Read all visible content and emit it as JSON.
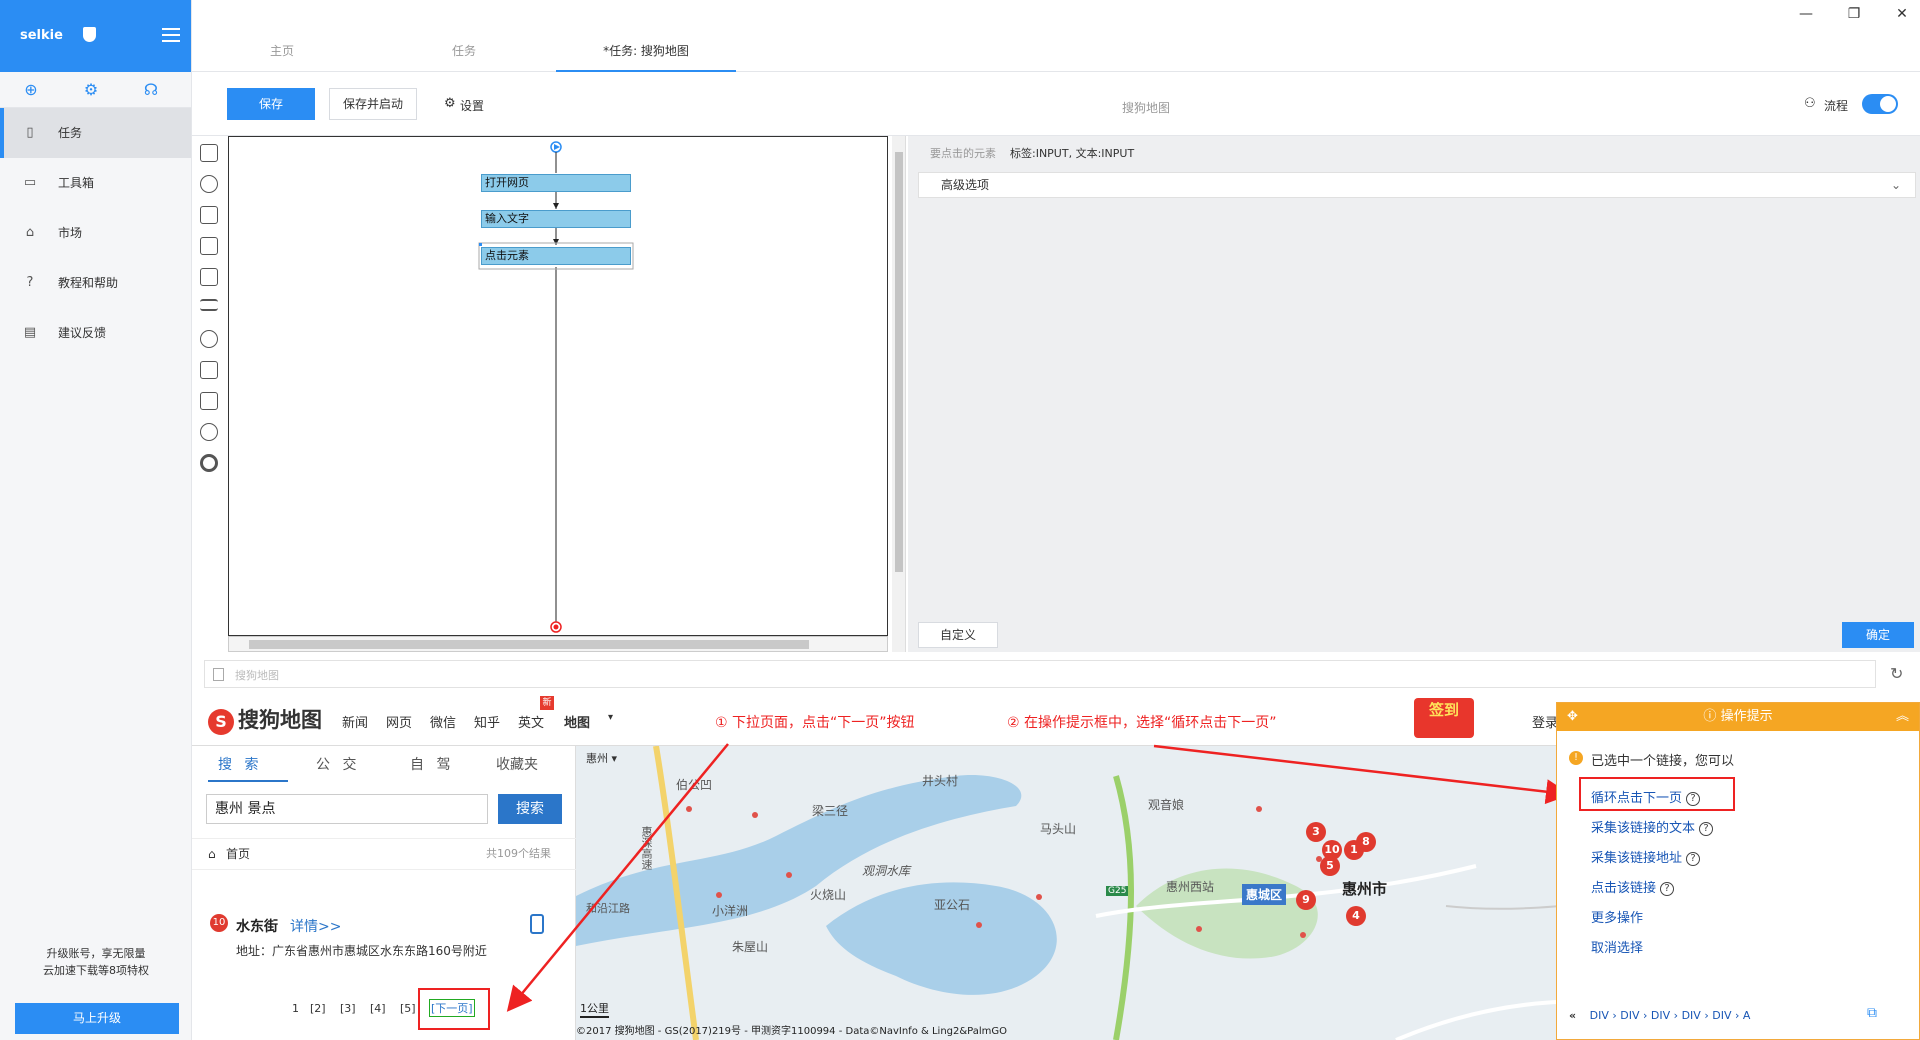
{
  "sidebar": {
    "brand": "selkie",
    "items": [
      {
        "label": "任务",
        "icon": "file-icon",
        "active": true
      },
      {
        "label": "工具箱",
        "icon": "toolbox-icon",
        "active": false
      },
      {
        "label": "市场",
        "icon": "lock-icon",
        "active": false
      },
      {
        "label": "教程和帮助",
        "icon": "help-icon",
        "active": false
      },
      {
        "label": "建议反馈",
        "icon": "feedback-icon",
        "active": false
      }
    ],
    "upgrade_line1": "升级账号，享无限量",
    "upgrade_line2": "云加速下载等8项特权",
    "upgrade_button": "马上升级"
  },
  "tabs": [
    {
      "label": "主页",
      "active": false
    },
    {
      "label": "任务",
      "active": false
    },
    {
      "label": "*任务: 搜狗地图",
      "active": true
    }
  ],
  "toolbar": {
    "save": "保存",
    "save_start": "保存并启动",
    "settings": "设置",
    "task_name": "搜狗地图",
    "flow_label": "流程",
    "flow_toggle_on": true
  },
  "flow": {
    "nodes": [
      "打开网页",
      "输入文字",
      "点击元素"
    ]
  },
  "props": {
    "target_label": "要点击的元素",
    "target_value": "标签:INPUT, 文本:INPUT",
    "advanced": "高级选项",
    "custom_btn": "自定义",
    "confirm_btn": "确定"
  },
  "browser": {
    "url": "搜狗地图"
  },
  "site": {
    "logo": "搜狗地图",
    "logo_letter": "S",
    "nav": [
      "新闻",
      "网页",
      "微信",
      "知乎",
      "英文",
      "地图"
    ],
    "nav_badge": "新",
    "annotation1": "① 下拉页面，点击“下一页”按钮",
    "annotation2": "② 在操作提示框中，选择“循环点击下一页”",
    "qiandao": "签到",
    "login": "登录",
    "search_tabs": [
      "搜 索",
      "公 交",
      "自 驾",
      "收藏夹"
    ],
    "search_value": "惠州 景点",
    "search_btn": "搜索",
    "home": "首页",
    "result_count": "共109个结果",
    "result_num": "10",
    "result_name": "水东街",
    "result_detail": "详情>>",
    "result_addr": "地址：广东省惠州市惠城区水东东路160号附近",
    "pages": [
      "1",
      "[2]",
      "[3]",
      "[4]",
      "[5]"
    ],
    "next_page": "[下一页]",
    "city": "惠州",
    "map_labels": [
      "伯公凹",
      "井头村",
      "梁三径",
      "观音娘",
      "马头山",
      "惠深高速",
      "观洞水库",
      "火烧山",
      "亚公石",
      "小洋洲",
      "和沿江路",
      "惠州西站",
      "惠城区",
      "惠州市",
      "G25",
      "朱屋山"
    ],
    "pins": [
      "3",
      "1",
      "8",
      "10",
      "5",
      "9",
      "4"
    ],
    "scale": "1公里",
    "copyright": "©2017 搜狗地图 - GS(2017)219号 - 甲测资字1100994 - Data©NavInfo & Ling2&PalmGO"
  },
  "tip": {
    "title": "操作提示",
    "intro": "已选中一个链接，您可以",
    "options": [
      "循环点击下一页",
      "采集该链接的文本",
      "采集该链接地址",
      "点击该链接",
      "更多操作",
      "取消选择"
    ],
    "crumb": [
      "«",
      "DIV",
      "DIV",
      "DIV",
      "DIV",
      "DIV",
      "A"
    ]
  },
  "colors": {
    "accent": "#2b8df3",
    "annotation": "#ee2222",
    "tip": "#f5a623"
  }
}
